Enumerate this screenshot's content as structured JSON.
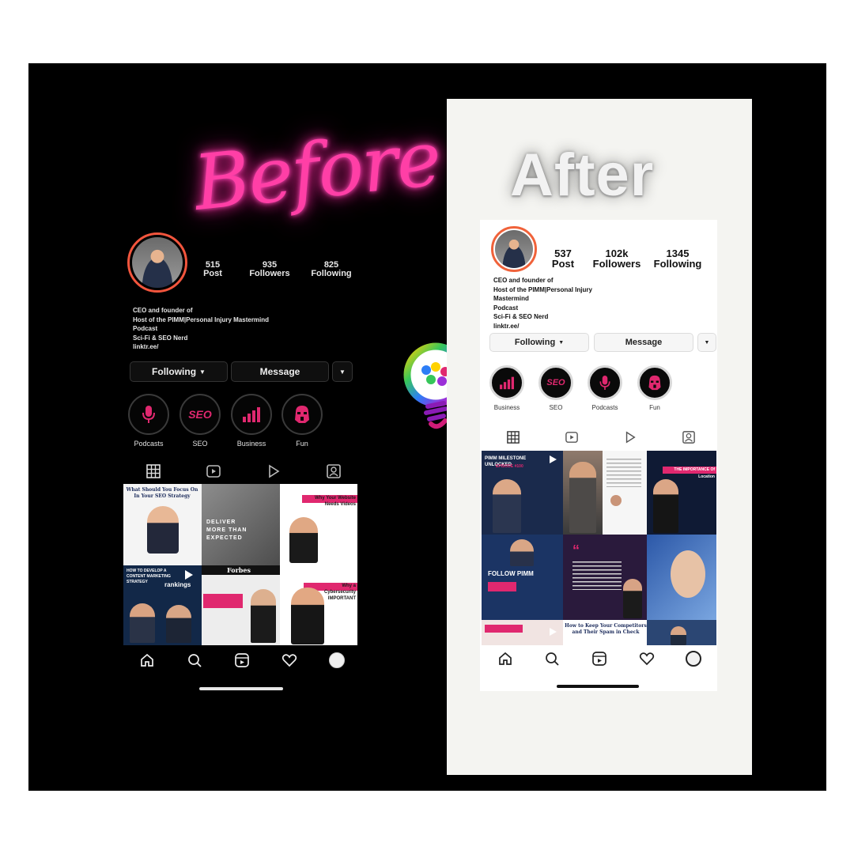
{
  "before": {
    "heading": "Before",
    "stats": [
      {
        "value": "515",
        "label": "Post"
      },
      {
        "value": "935",
        "label": "Followers"
      },
      {
        "value": "825",
        "label": "Following"
      }
    ],
    "bio": [
      "CEO and founder of",
      "Host of the PIMM|Personal Injury Mastermind",
      "Podcast",
      "Sci-Fi & SEO Nerd",
      "linktr.ee/"
    ],
    "buttons": {
      "following": "Following",
      "message": "Message"
    },
    "highlights": [
      "Podcasts",
      "SEO",
      "Business",
      "Fun"
    ],
    "posts": {
      "tile1_title": "What Should You Focus On In Your SEO Strategy",
      "tile2_text": "DELIVER MORE THAN EXPECTED",
      "tile3_text": "Why Your Website Needs Videos",
      "tile4_text": "HOW TO DEVELOP A CONTENT MARKETING STRATEGY",
      "tile4_brand": "rankings",
      "tile5_brand": "Forbes",
      "tile6_text": "Why a Cybersecurity IMPORTANT"
    }
  },
  "after": {
    "heading": "After",
    "stats": [
      {
        "value": "537",
        "label": "Post"
      },
      {
        "value": "102k",
        "label": "Followers"
      },
      {
        "value": "1345",
        "label": "Following"
      }
    ],
    "bio": [
      "CEO and founder of",
      "Host of the PIMM|Personal Injury",
      "Mastermind",
      "Podcast",
      "Sci-Fi & SEO Nerd",
      "linktr.ee/"
    ],
    "buttons": {
      "following": "Following",
      "message": "Message"
    },
    "highlights": [
      "Business",
      "SEO",
      "Podcasts",
      "Fun"
    ],
    "posts": {
      "tile1_text": "PIMM MILESTONE UNLOCKED",
      "tile1_sub": "EPISODE #100",
      "tile4_text": "THE IMPORTANCE Of Location",
      "tile5_text": "FOLLOW PIMM",
      "tile9_text": "How to Keep Your Competitors and Their Spam in Check"
    }
  },
  "colors": {
    "neon_pink": "#ff3fa6",
    "brand_pink": "#e0286f",
    "dark_bg": "#000000",
    "light_bg": "#ffffff"
  }
}
